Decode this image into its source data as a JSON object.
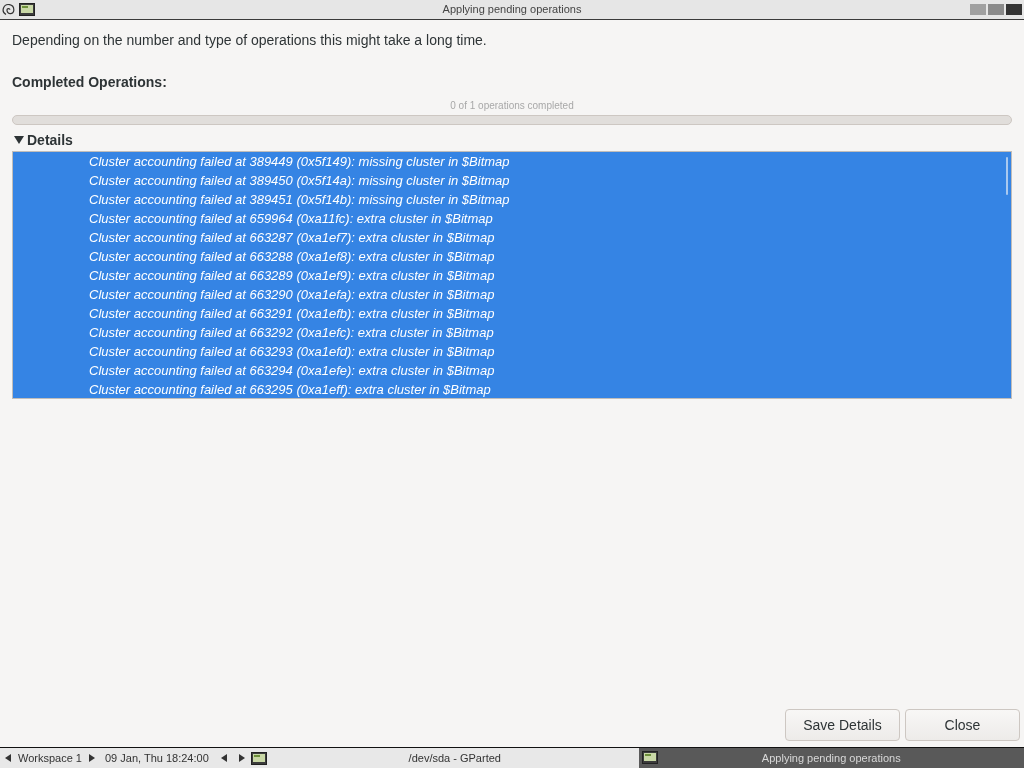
{
  "window": {
    "title": "Applying pending operations"
  },
  "message": "Depending on the number and type of operations this might take a long time.",
  "completed_label": "Completed Operations:",
  "progress": {
    "text": "0 of 1 operations completed",
    "level": 0
  },
  "details": {
    "label": "Details",
    "expanded": true,
    "selected": true,
    "lines": [
      "Cluster accounting failed at 389449 (0x5f149): missing cluster in $Bitmap",
      "Cluster accounting failed at 389450 (0x5f14a): missing cluster in $Bitmap",
      "Cluster accounting failed at 389451 (0x5f14b): missing cluster in $Bitmap",
      "Cluster accounting failed at 659964 (0xa11fc): extra cluster in $Bitmap",
      "Cluster accounting failed at 663287 (0xa1ef7): extra cluster in $Bitmap",
      "Cluster accounting failed at 663288 (0xa1ef8): extra cluster in $Bitmap",
      "Cluster accounting failed at 663289 (0xa1ef9): extra cluster in $Bitmap",
      "Cluster accounting failed at 663290 (0xa1efa): extra cluster in $Bitmap",
      "Cluster accounting failed at 663291 (0xa1efb): extra cluster in $Bitmap",
      "Cluster accounting failed at 663292 (0xa1efc): extra cluster in $Bitmap",
      "Cluster accounting failed at 663293 (0xa1efd): extra cluster in $Bitmap",
      "Cluster accounting failed at 663294 (0xa1efe): extra cluster in $Bitmap",
      "Cluster accounting failed at 663295 (0xa1eff): extra cluster in $Bitmap"
    ]
  },
  "buttons": [
    "Save Details",
    "Close"
  ],
  "taskbar": {
    "workspace": "Workspace 1",
    "clock": "09 Jan, Thu 18:24:00",
    "tasks": [
      {
        "label": "/dev/sda - GParted",
        "selected": false
      },
      {
        "label": "Applying pending operations",
        "selected": true
      }
    ]
  }
}
